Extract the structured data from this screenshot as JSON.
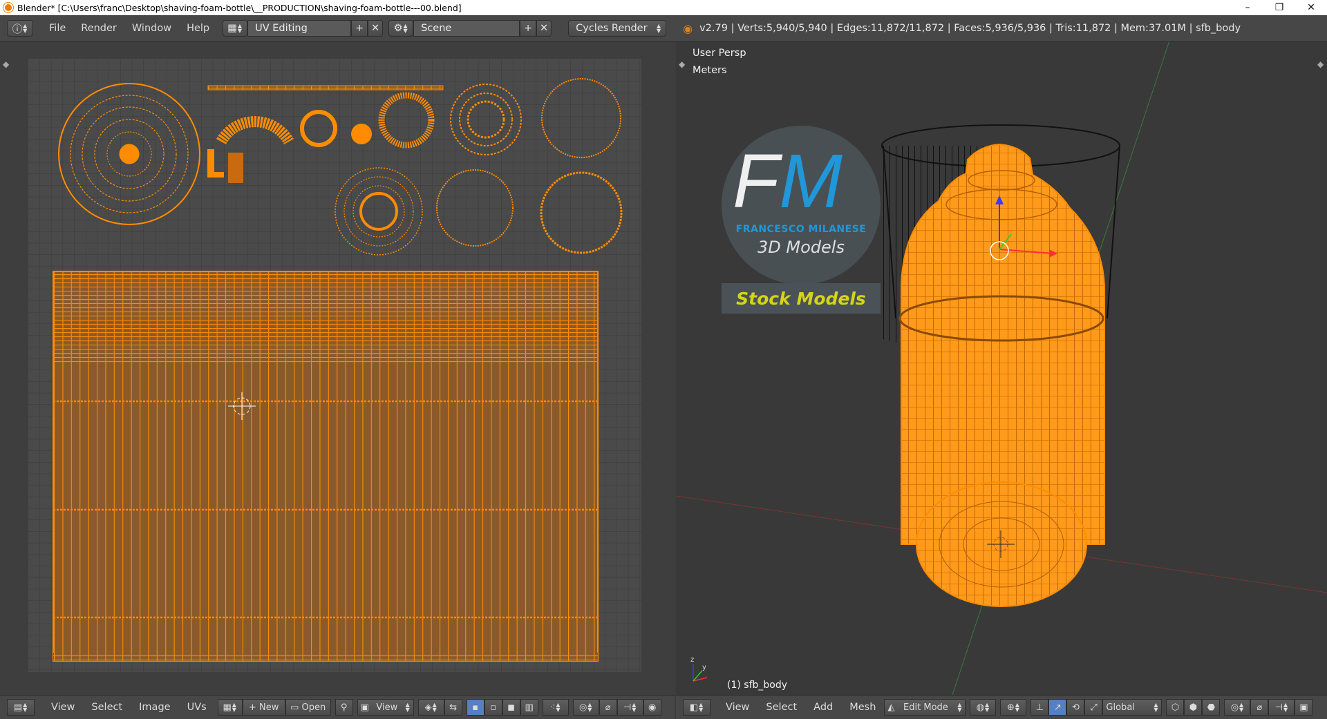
{
  "window": {
    "title": "Blender* [C:\\Users\\franc\\Desktop\\shaving-foam-bottle\\__PRODUCTION\\shaving-foam-bottle---00.blend]",
    "controls": {
      "minimize": "–",
      "maximize": "❐",
      "close": "✕"
    }
  },
  "top_menu": [
    "File",
    "Render",
    "Window",
    "Help"
  ],
  "screen_layout": "UV Editing",
  "scene": "Scene",
  "render_engine": "Cycles Render",
  "stats": "v2.79 | Verts:5,940/5,940 | Edges:11,872/11,872 | Faces:5,936/5,936 | Tris:11,872 | Mem:37.01M | sfb_body",
  "uv_header": {
    "menus": [
      "View",
      "Select",
      "Image",
      "UVs"
    ],
    "new_label": "New",
    "open_label": "Open",
    "view_label": "View"
  },
  "viewport": {
    "view_name": "User Persp",
    "units": "Meters",
    "object_label": "(1) sfb_body"
  },
  "view3d_header": {
    "menus": [
      "View",
      "Select",
      "Add",
      "Mesh"
    ],
    "mode": "Edit Mode",
    "orientation": "Global"
  },
  "watermark": {
    "letters_f": "F",
    "letters_m": "M",
    "brand": "FRANCESCO MILANESE",
    "subtitle": "3D Models",
    "banner": "Stock Models"
  },
  "colors": {
    "accent_orange": "#ff8c00",
    "uv_fill": "#8a5a2b",
    "blender_blue": "#5680c2"
  }
}
